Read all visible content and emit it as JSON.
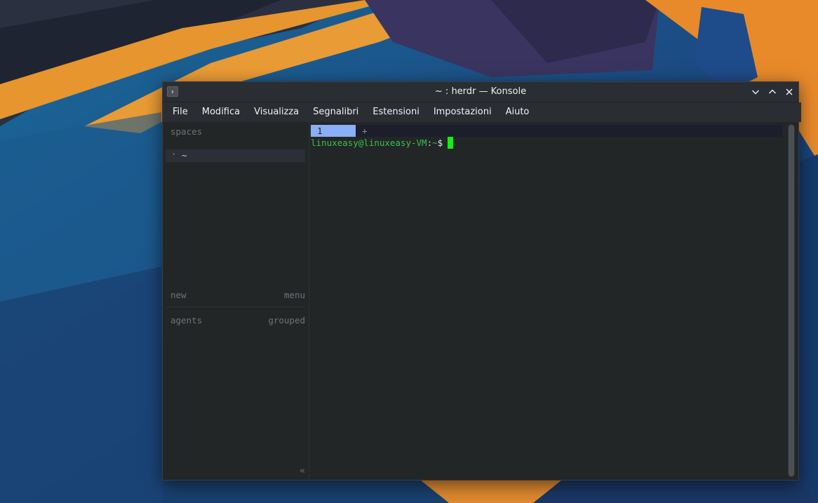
{
  "window": {
    "title": "~ : herdr — Konsole"
  },
  "menu": [
    "File",
    "Modifica",
    "Visualizza",
    "Segnalibri",
    "Estensioni",
    "Impostazioni",
    "Aiuto"
  ],
  "sidebar": {
    "heading": "spaces",
    "space_dot": "·",
    "space_name": "~",
    "new_label": "new",
    "menu_label": "menu",
    "agents_label": "agents",
    "grouped_label": "grouped",
    "collapse_glyph": "«"
  },
  "tabs": {
    "active_label": "1",
    "add_label": "+"
  },
  "terminal": {
    "user_host": "linuxeasy@linuxeasy-VM",
    "separator": ":",
    "path": "~",
    "dollar": "$"
  },
  "colors": {
    "accent_tab": "#8aaef7",
    "prompt_green": "#37c14a",
    "cursor_green": "#13f013",
    "terminal_bg": "#232627"
  },
  "icons": {
    "app": "konsole-icon",
    "minimize": "chevron-down-icon",
    "maximize": "chevron-up-icon",
    "close": "close-icon"
  }
}
